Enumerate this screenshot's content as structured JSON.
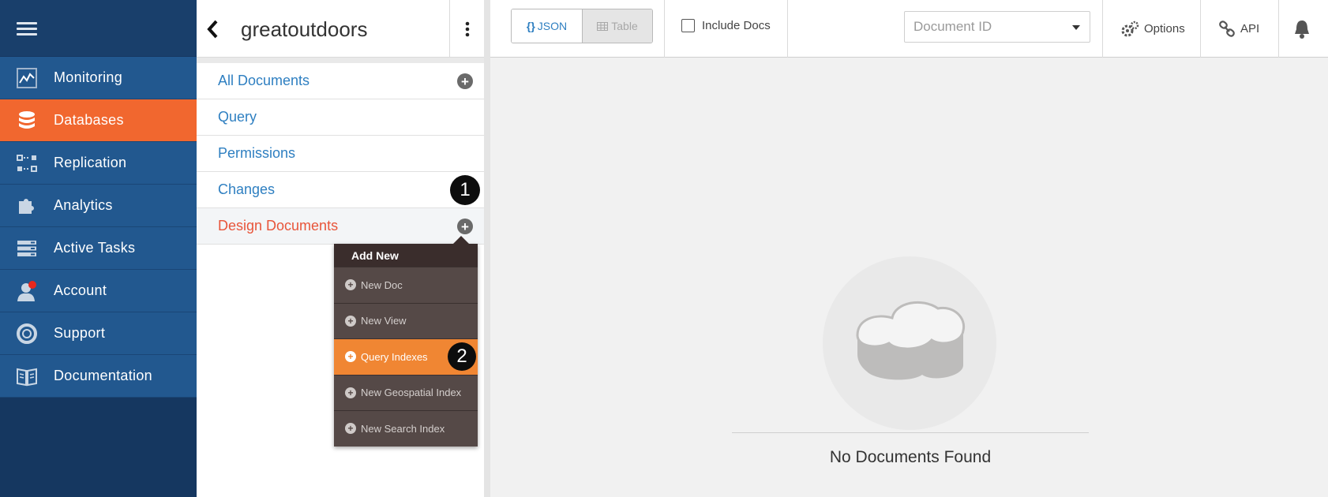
{
  "nav": {
    "items": [
      {
        "label": "Monitoring",
        "icon": "monitoring-icon",
        "active": false
      },
      {
        "label": "Databases",
        "icon": "database-icon",
        "active": true
      },
      {
        "label": "Replication",
        "icon": "replication-icon",
        "active": false
      },
      {
        "label": "Analytics",
        "icon": "puzzle-icon",
        "active": false
      },
      {
        "label": "Active Tasks",
        "icon": "tasks-icon",
        "active": false
      },
      {
        "label": "Account",
        "icon": "account-icon",
        "active": false
      },
      {
        "label": "Support",
        "icon": "lifebuoy-icon",
        "active": false
      },
      {
        "label": "Documentation",
        "icon": "book-icon",
        "active": false
      }
    ]
  },
  "sidebar": {
    "db_name": "greatoutdoors",
    "items": [
      {
        "label": "All Documents"
      },
      {
        "label": "Query"
      },
      {
        "label": "Permissions"
      },
      {
        "label": "Changes"
      },
      {
        "label": "Design Documents"
      }
    ]
  },
  "callouts": {
    "one": "1",
    "two": "2"
  },
  "dropdown": {
    "header": "Add New",
    "items": [
      {
        "label": "New Doc"
      },
      {
        "label": "New View"
      },
      {
        "label": "Query Indexes"
      },
      {
        "label": "New Geospatial Index"
      },
      {
        "label": "New Search Index"
      }
    ]
  },
  "toolbar": {
    "json_label": "JSON",
    "table_label": "Table",
    "include_docs_label": "Include Docs",
    "document_id_placeholder": "Document ID",
    "options_label": "Options",
    "api_label": "API"
  },
  "main": {
    "empty_message": "No Documents Found"
  },
  "colors": {
    "nav_bg": "#153760",
    "nav_item": "#22588f",
    "active_orange": "#f1672f",
    "link_blue": "#2e7fc1",
    "design_red": "#e8553a",
    "dropdown_bg": "#554947",
    "dropdown_active": "#f08633"
  }
}
